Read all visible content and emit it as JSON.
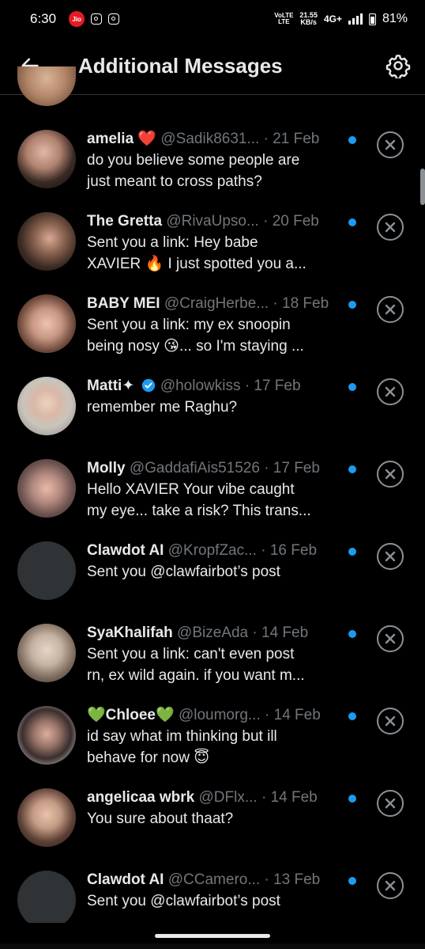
{
  "status_bar": {
    "time": "6:30",
    "carrier_badge": "Jio",
    "volte_line1": "VoLTE",
    "volte_line2": "LTE",
    "speed_value": "21.55",
    "speed_unit": "KB/s",
    "network": "4G+",
    "battery": "81%"
  },
  "header": {
    "title": "Additional Messages",
    "back_icon": "arrow-left-icon",
    "settings_icon": "gear-icon"
  },
  "colors": {
    "background": "#000000",
    "primary_text": "#e7e9ea",
    "secondary_text": "#71767b",
    "unread_dot": "#1d9bf0",
    "dismiss_icon": "#8b9095",
    "divider": "#2f3336",
    "verified": "#1d9bf0"
  },
  "messages": [
    {
      "name": "amelia ❤️",
      "handle": "@Sadik8631...",
      "date": " · 21 Feb",
      "text": "do you believe some people are\njust meant to cross paths?",
      "verified": false,
      "unread": true,
      "avatar": "photo"
    },
    {
      "name": "The Gretta",
      "handle": "@RivaUpso...",
      "date": " · 20 Feb",
      "text": "Sent you a link: Hey babe\nXAVIER 🔥 I just spotted you a...",
      "verified": false,
      "unread": true,
      "avatar": "photo"
    },
    {
      "name": "BABY MEI",
      "handle": "@CraigHerbe...",
      "date": " · 18 Feb",
      "text": "Sent you a link: my ex snoopin\nbeing nosy 😘... so I'm staying ...",
      "verified": false,
      "unread": true,
      "avatar": "photo"
    },
    {
      "name": "Matti✦",
      "handle": "@holowkiss",
      "date": " · 17 Feb",
      "text": "remember me Raghu?",
      "verified": true,
      "unread": true,
      "avatar": "photo"
    },
    {
      "name": "Molly",
      "handle": "@GaddafiAis51526",
      "date": " · 17 Feb",
      "text": "Hello XAVIER  Your vibe caught\nmy eye... take a risk? This trans...",
      "verified": false,
      "unread": true,
      "avatar": "photo"
    },
    {
      "name": "Clawdot AI",
      "handle": "@KropfZac...",
      "date": " · 16 Feb",
      "text": "Sent you @clawfairbot’s post",
      "verified": false,
      "unread": true,
      "avatar": "blank"
    },
    {
      "name": "SyaKhalifah",
      "handle": "@BizeAda",
      "date": " · 14 Feb",
      "text": "Sent you a link: can't even post\nrn, ex wild again. if you want m...",
      "verified": false,
      "unread": true,
      "avatar": "photo"
    },
    {
      "name": "💚Chloee💚",
      "handle": "@loumorg...",
      "date": " · 14 Feb",
      "text": "id say what im thinking but ill\nbehave for now 😇",
      "verified": false,
      "unread": true,
      "avatar": "photo"
    },
    {
      "name": "angelicaa wbrk",
      "handle": "@DFlx...",
      "date": " · 14 Feb",
      "text": "You sure about thaat?",
      "verified": false,
      "unread": true,
      "avatar": "photo"
    },
    {
      "name": "Clawdot AI",
      "handle": "@CCamero...",
      "date": " · 13 Feb",
      "text": "Sent you @clawfairbot’s post",
      "verified": false,
      "unread": true,
      "avatar": "blank"
    }
  ]
}
